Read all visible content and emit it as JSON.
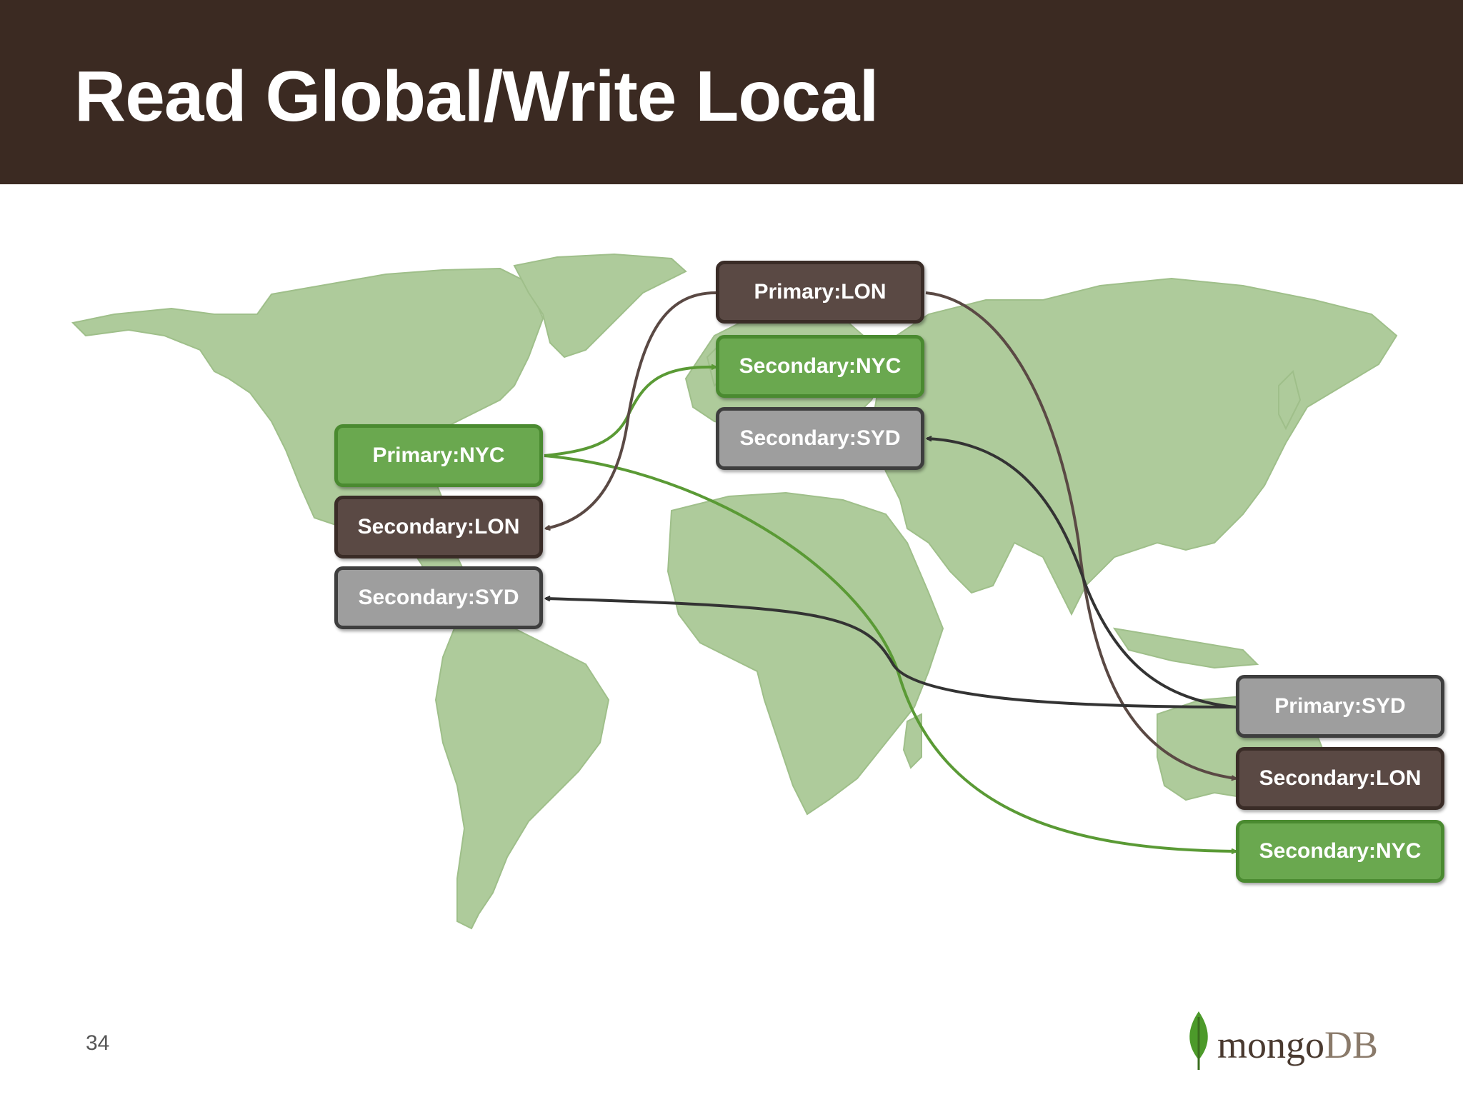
{
  "slide": {
    "title": "Read Global/Write Local",
    "page_number": "34",
    "logo": {
      "text_mongo": "mongo",
      "text_db": "DB",
      "leaf_color": "#4c9a2a"
    }
  },
  "colors": {
    "header_bg": "#3b2a22",
    "map_land": "#aecb9b",
    "brown": "#5a4944",
    "green": "#6aa84f",
    "gray": "#9e9e9e",
    "dark_arrow": "#333333",
    "green_arrow": "#5a9a35",
    "brown_arrow": "#5a4944"
  },
  "nodes": {
    "lon_primary": "Primary:LON",
    "lon_secondary_nyc": "Secondary:NYC",
    "lon_secondary_syd": "Secondary:SYD",
    "nyc_primary": "Primary:NYC",
    "nyc_secondary_lon": "Secondary:LON",
    "nyc_secondary_syd": "Secondary:SYD",
    "syd_primary": "Primary:SYD",
    "syd_secondary_lon": "Secondary:LON",
    "syd_secondary_nyc": "Secondary:NYC"
  },
  "edges": [
    {
      "from": "Primary:NYC",
      "to": "Secondary:NYC",
      "color": "green"
    },
    {
      "from": "Primary:NYC",
      "to": "Secondary:NYC",
      "color": "green"
    },
    {
      "from": "Primary:LON",
      "to": "Secondary:LON",
      "color": "brown"
    },
    {
      "from": "Primary:LON",
      "to": "Secondary:LON",
      "color": "brown"
    },
    {
      "from": "Primary:SYD",
      "to": "Secondary:SYD",
      "color": "dark"
    },
    {
      "from": "Primary:SYD",
      "to": "Secondary:SYD",
      "color": "dark"
    }
  ]
}
